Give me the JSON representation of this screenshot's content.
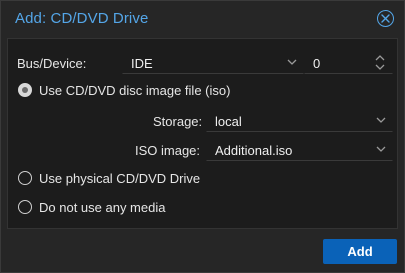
{
  "dialog": {
    "title": "Add: CD/DVD Drive",
    "close_icon": "close-circle-icon"
  },
  "form": {
    "bus_device_label": "Bus/Device:",
    "bus_value": "IDE",
    "device_value": "0",
    "option_iso_label": "Use CD/DVD disc image file (iso)",
    "storage_label": "Storage:",
    "storage_value": "local",
    "iso_label": "ISO image:",
    "iso_value": "Additional.iso",
    "option_physical_label": "Use physical CD/DVD Drive",
    "option_none_label": "Do not use any media",
    "selected_option": "iso"
  },
  "footer": {
    "add_label": "Add"
  },
  "colors": {
    "accent": "#54a6e8",
    "primary_button": "#0a62b8"
  }
}
